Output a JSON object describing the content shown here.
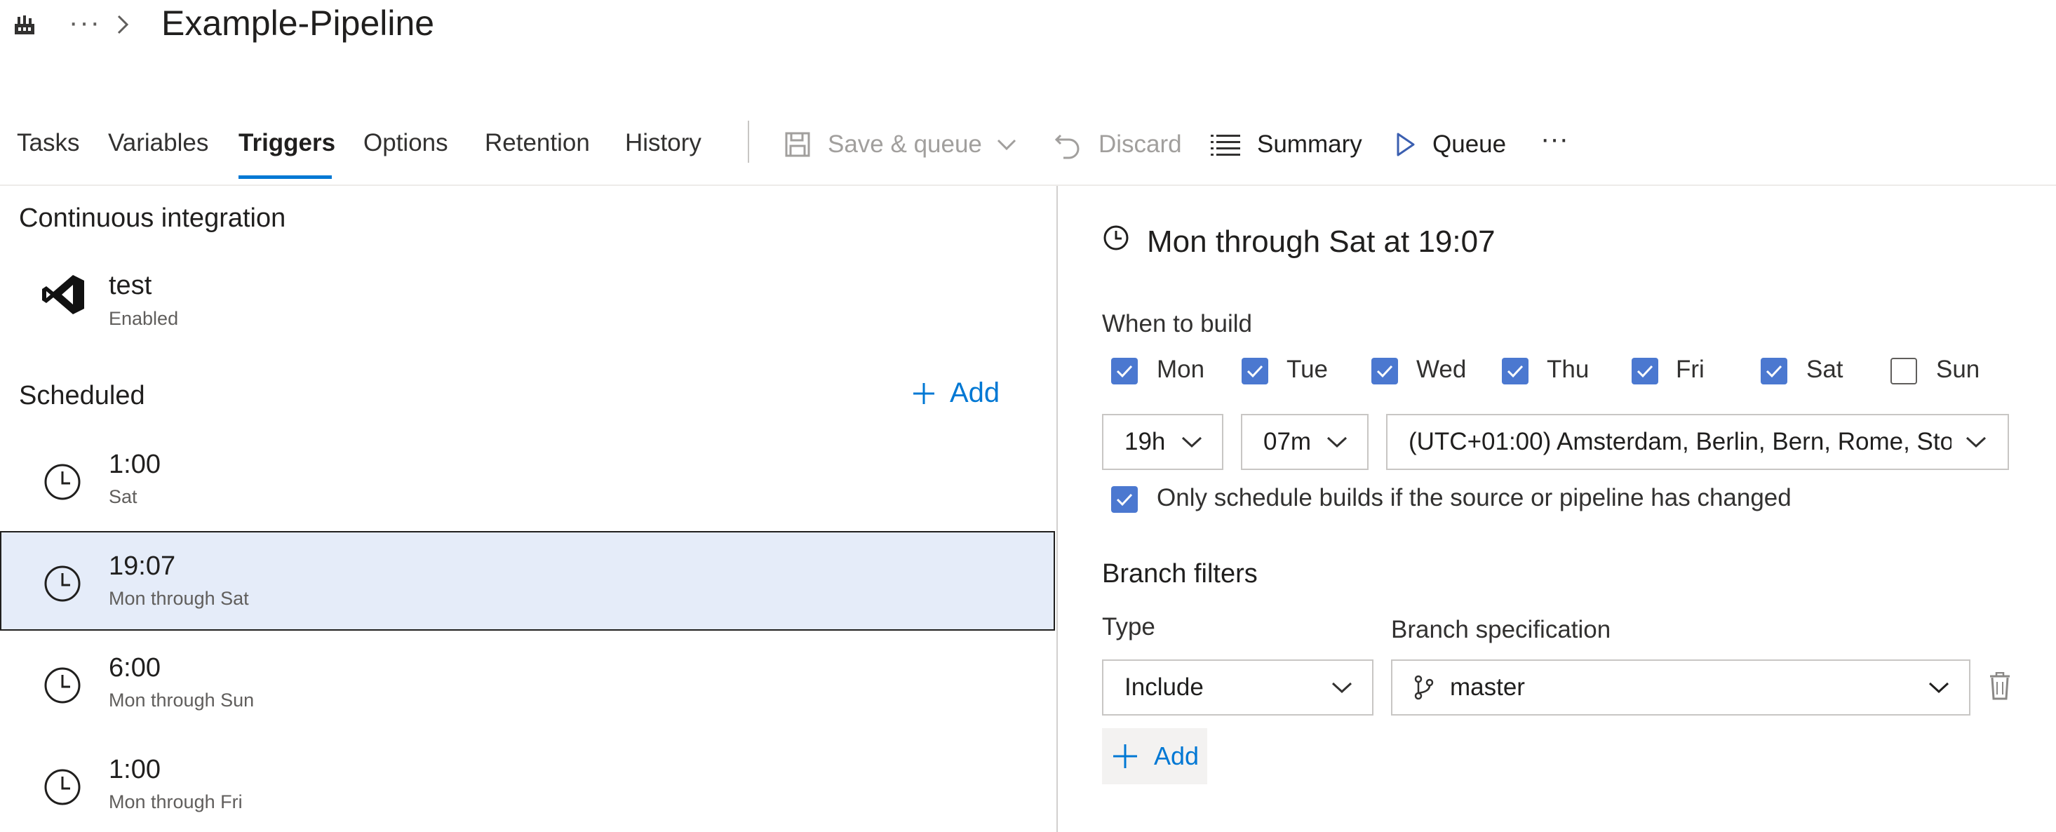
{
  "header": {
    "breadcrumb_more": "···",
    "title": "Example-Pipeline"
  },
  "tabs": [
    {
      "label": "Tasks"
    },
    {
      "label": "Variables"
    },
    {
      "label": "Triggers",
      "active": true
    },
    {
      "label": "Options"
    },
    {
      "label": "Retention"
    },
    {
      "label": "History"
    }
  ],
  "commands": {
    "save_queue": "Save & queue",
    "discard": "Discard",
    "summary": "Summary",
    "queue": "Queue",
    "more": "···"
  },
  "left": {
    "ci_heading": "Continuous integration",
    "ci_item": {
      "title": "test",
      "status": "Enabled"
    },
    "scheduled_heading": "Scheduled",
    "add_label": "Add",
    "schedules": [
      {
        "time": "1:00",
        "days": "Sat"
      },
      {
        "time": "19:07",
        "days": "Mon through Sat",
        "selected": true
      },
      {
        "time": "6:00",
        "days": "Mon through Sun"
      },
      {
        "time": "1:00",
        "days": "Mon through Fri"
      }
    ]
  },
  "right": {
    "title": "Mon through Sat at 19:07",
    "when_label": "When to build",
    "days": [
      {
        "label": "Mon",
        "checked": true
      },
      {
        "label": "Tue",
        "checked": true
      },
      {
        "label": "Wed",
        "checked": true
      },
      {
        "label": "Thu",
        "checked": true
      },
      {
        "label": "Fri",
        "checked": true
      },
      {
        "label": "Sat",
        "checked": true
      },
      {
        "label": "Sun",
        "checked": false
      }
    ],
    "hour": "19h",
    "minute": "07m",
    "timezone": "(UTC+01:00) Amsterdam, Berlin, Bern, Rome, Sto...",
    "only_changed_label": "Only schedule builds if the source or pipeline has changed",
    "only_changed_checked": true,
    "branch_filters_heading": "Branch filters",
    "type_label": "Type",
    "type_value": "Include",
    "branch_spec_label": "Branch specification",
    "branch_value": "master",
    "add_label": "Add"
  },
  "colors": {
    "accent": "#0078d4",
    "checkbox": "#4b78d0",
    "selected_row": "#e5ecf9"
  }
}
